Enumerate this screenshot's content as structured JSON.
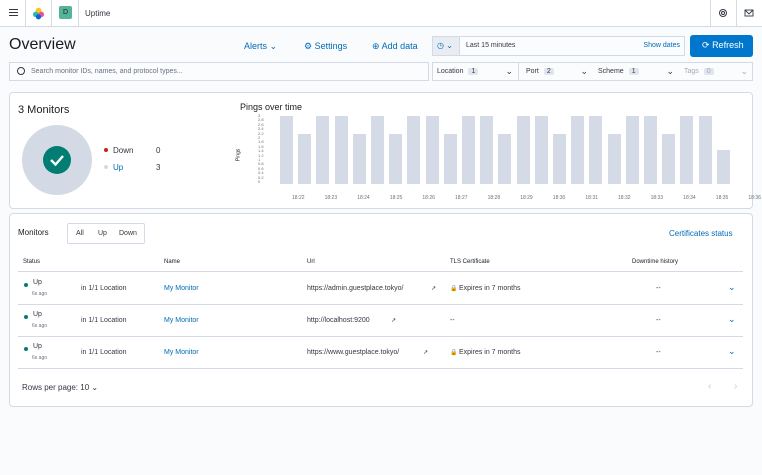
{
  "topbar": {
    "space_letter": "D",
    "app_name": "Uptime"
  },
  "header": {
    "title": "Overview",
    "alerts": "Alerts",
    "settings": "Settings",
    "add_data": "Add data",
    "date_range": "Last 15 minutes",
    "show_dates": "Show dates",
    "refresh": "Refresh"
  },
  "search": {
    "placeholder": "Search monitor IDs, names, and protocol types..."
  },
  "filters": [
    {
      "label": "Location",
      "count": "1"
    },
    {
      "label": "Port",
      "count": "2"
    },
    {
      "label": "Scheme",
      "count": "1"
    },
    {
      "label": "Tags",
      "count": "0"
    }
  ],
  "summary": {
    "title": "3 Monitors",
    "down_label": "Down",
    "down_count": "0",
    "up_label": "Up",
    "up_count": "3",
    "colors": {
      "down": "#bd271e",
      "up": "#d3dae6",
      "check": "#017d73"
    }
  },
  "pings_chart_title": "Pings over time",
  "pings_axis_label": "Pings",
  "chart_data": {
    "type": "bar",
    "title": "Pings over time",
    "ylabel": "Pings",
    "ylim": [
      0,
      3
    ],
    "yticks": [
      "3",
      "2.8",
      "2.6",
      "2.4",
      "2.2",
      "2",
      "1.8",
      "1.6",
      "1.4",
      "1.2",
      "1",
      "0.8",
      "0.6",
      "0.4",
      "0.2",
      "0"
    ],
    "xticks": [
      "18:22",
      "18:23",
      "18:24",
      "18:25",
      "18:26",
      "18:27",
      "18:28",
      "18:29",
      "18:30",
      "18:31",
      "18:32",
      "18:33",
      "18:34",
      "18:35",
      "18:36"
    ],
    "values": [
      3,
      2.2,
      3,
      3,
      2.2,
      3,
      2.2,
      3,
      3,
      2.2,
      3,
      3,
      2.2,
      3,
      3,
      2.2,
      3,
      3,
      2.2,
      3,
      3,
      2.2,
      3,
      3,
      1.5
    ],
    "color": "#d4dae6"
  },
  "monitors": {
    "title": "Monitors",
    "filter_all": "All",
    "filter_up": "Up",
    "filter_down": "Down",
    "cert_link": "Certificates status",
    "headers": {
      "status": "Status",
      "name": "Name",
      "url": "Url",
      "tls": "TLS Certificate",
      "downtime": "Downtime history"
    },
    "rows": [
      {
        "status": "Up",
        "ago": "6s ago",
        "location": "in 1/1 Location",
        "name": "My Monitor",
        "url": "https://admin.guestplace.tokyo/",
        "tls": "Expires in 7 months",
        "downtime": "--"
      },
      {
        "status": "Up",
        "ago": "6s ago",
        "location": "in 1/1 Location",
        "name": "My Monitor",
        "url": "http://localhost:9200",
        "tls": "--",
        "downtime": "--"
      },
      {
        "status": "Up",
        "ago": "6s ago",
        "location": "in 1/1 Location",
        "name": "My Monitor",
        "url": "https://www.guestplace.tokyo/",
        "tls": "Expires in 7 months",
        "downtime": "--"
      }
    ],
    "rows_per_page": "Rows per page: 10"
  }
}
